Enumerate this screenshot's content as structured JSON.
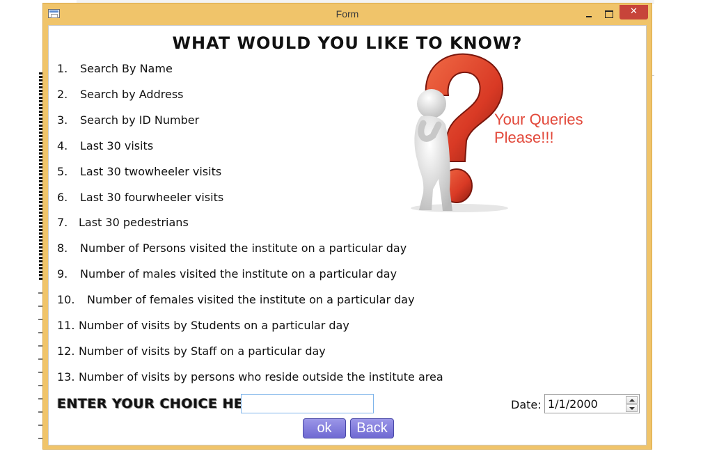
{
  "window": {
    "title": "Form",
    "close_glyph": "✕"
  },
  "heading": "WHAT WOULD YOU LIKE TO KNOW?",
  "side_text": "Your Queries Please!!!",
  "options": [
    {
      "num": "1.",
      "text": "Search By Name"
    },
    {
      "num": "2.",
      "text": "Search by Address"
    },
    {
      "num": "3.",
      "text": "Search by ID Number"
    },
    {
      "num": "4.",
      "text": "Last 30 visits"
    },
    {
      "num": "5.",
      "text": "Last 30 twowheeler visits"
    },
    {
      "num": "6.",
      "text": "Last 30 fourwheeler visits"
    },
    {
      "num": "7.",
      "text": "Last 30 pedestrians"
    },
    {
      "num": "8.",
      "text": "Number of Persons visited the institute on a particular day"
    },
    {
      "num": "9.",
      "text": "Number of males visited the institute on a particular day"
    },
    {
      "num": "10.",
      "text": "Number of females visited the institute on a particular day"
    },
    {
      "num": "11.",
      "text": "Number of visits by Students on a particular day"
    },
    {
      "num": "12.",
      "text": "Number of visits by Staff on a particular day"
    },
    {
      "num": "13.",
      "text": "Number of visits by persons who reside outside the institute area"
    }
  ],
  "choice": {
    "label": "ENTER YOUR CHOICE HERE:",
    "value": ""
  },
  "date": {
    "label": "Date:",
    "value": "1/1/2000"
  },
  "buttons": {
    "ok": "ok",
    "back": "Back"
  },
  "colors": {
    "accent_red": "#e2483a",
    "frame": "#f0c46a",
    "button": "#6f69d2"
  },
  "icons": [
    "app-icon",
    "minimize-icon",
    "maximize-icon",
    "close-icon",
    "thinking-figure-question-mark"
  ]
}
